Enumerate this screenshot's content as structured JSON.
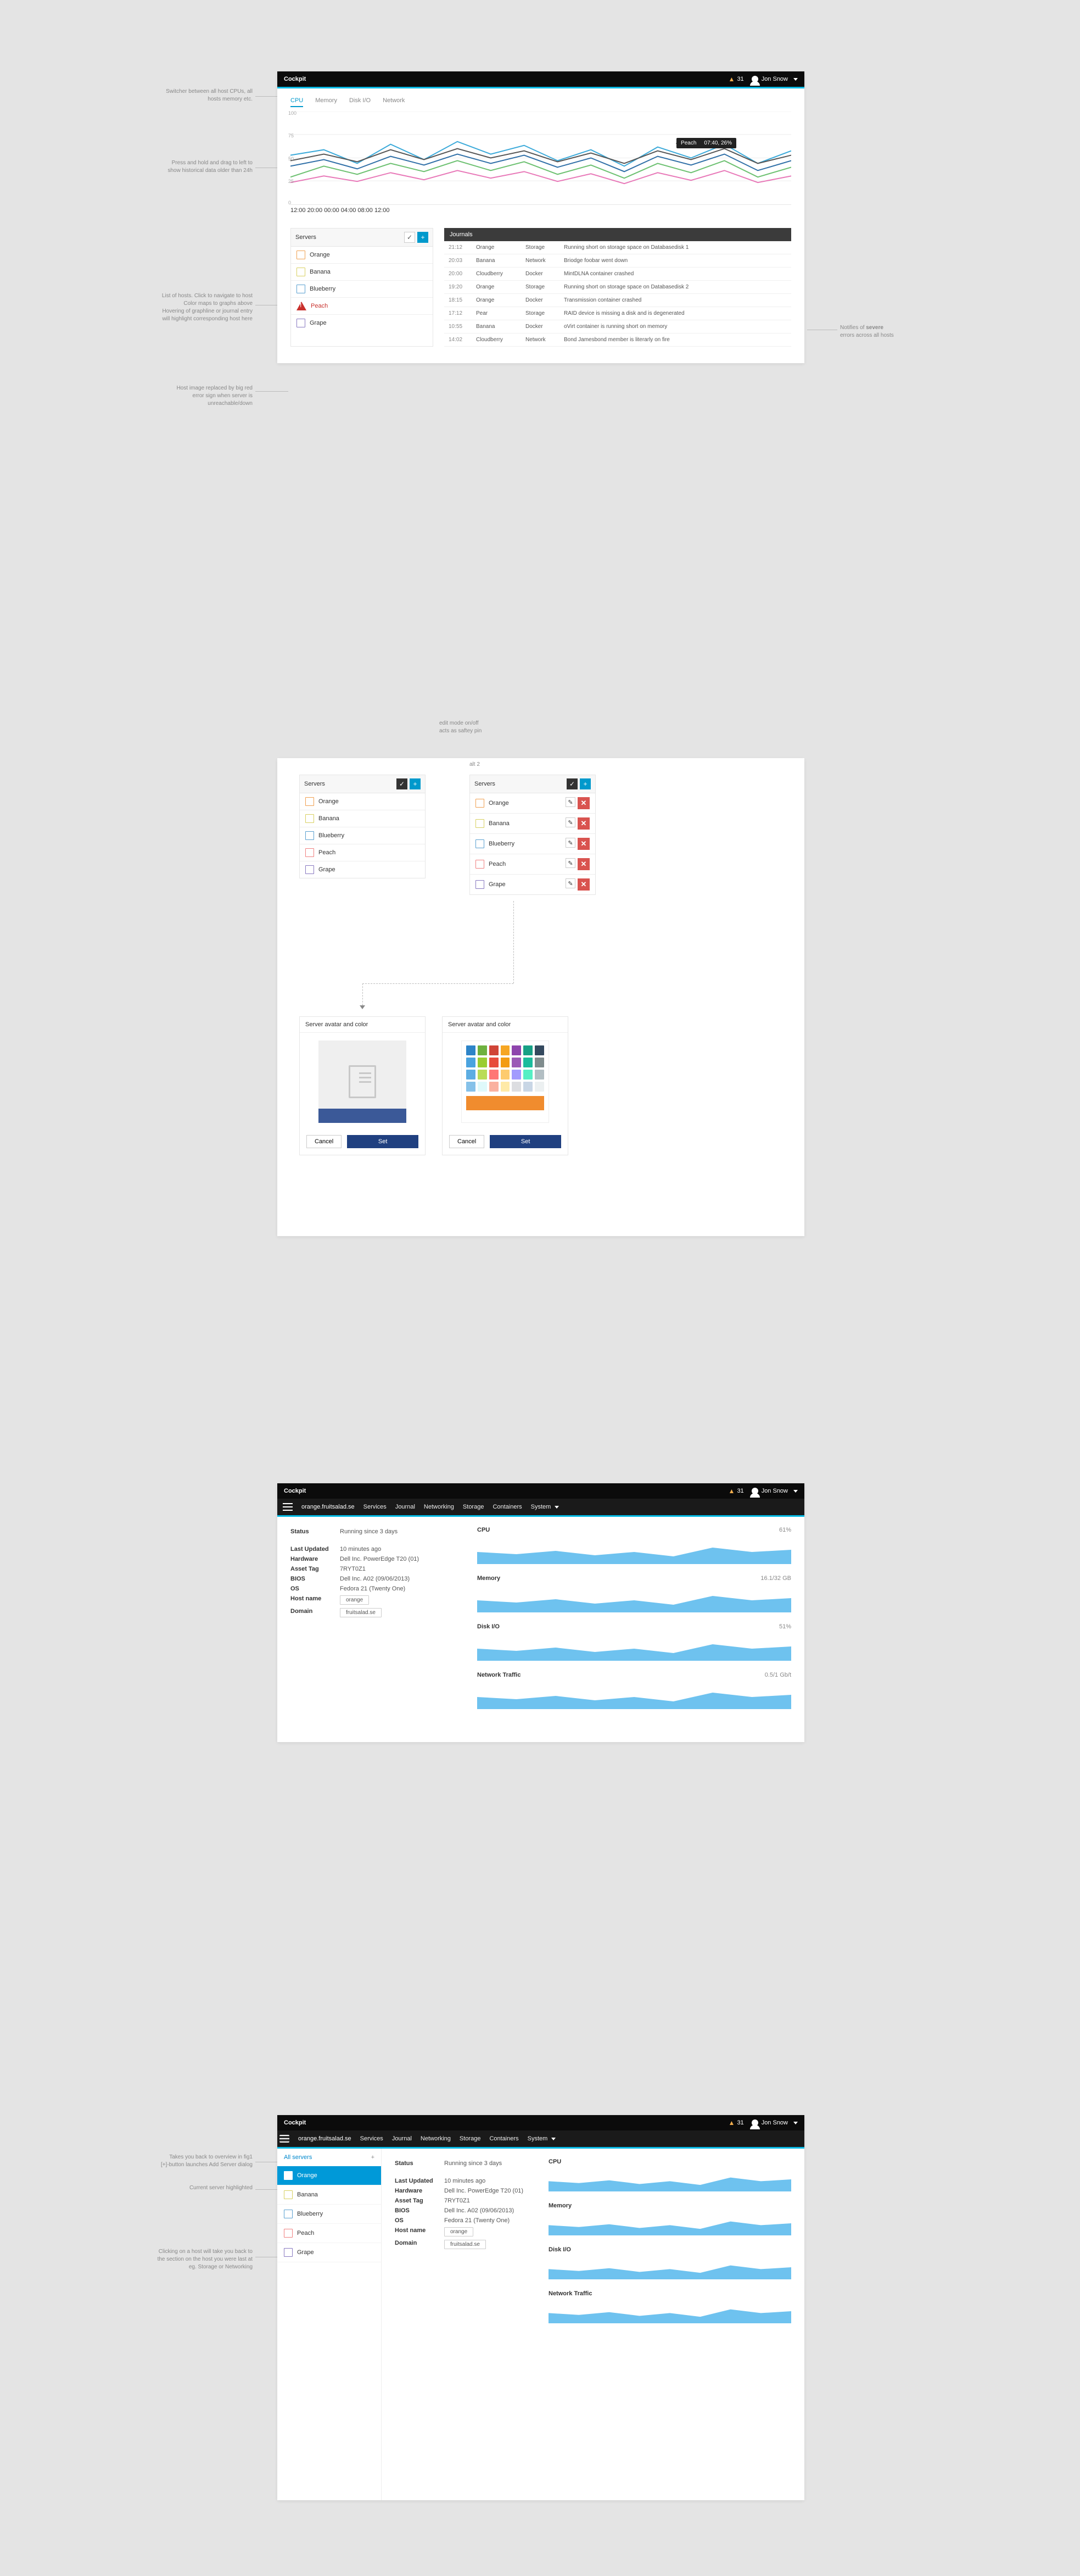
{
  "common": {
    "brand": "Cockpit",
    "alert_count": "31",
    "user_name": "Jon Snow"
  },
  "annotations": {
    "a1": "Switcher between all host CPUs, all\nhosts memory etc.",
    "a2": "Press and hold and drag to left to\nshow historical data older than 24h",
    "a3": "List of hosts. Click to navigate to host\nColor maps to graphs above\nHovering of graphline or journal entry\nwill highlight corresponding host here",
    "a4": "Host image replaced by big red\nerror sign when server is\nunreachable/down",
    "a5": "Notifies of severe\nerrors across all hosts",
    "a6": "edit mode on/off\nacts as saftey pin",
    "a6b": "alt 2",
    "a7": "Takes you back to overview in fig1\n[+]-button launches Add Server dialog",
    "a8": "Current server highlighted",
    "a9": "Clicking on a host will take you back to\nthe section on the host you were last at\neg. Storage or Networking"
  },
  "mock1": {
    "tabs": [
      "CPU",
      "Memory",
      "Disk I/O",
      "Network"
    ],
    "active_tab": 0,
    "y_ticks": [
      "100",
      "75",
      "50",
      "25",
      "0"
    ],
    "x_ticks": [
      "12:00",
      "20:00",
      "00:00",
      "04:00",
      "08:00",
      "12:00"
    ],
    "tooltip": {
      "host": "Peach",
      "value": "07:40, 26%"
    },
    "servers_title": "Servers",
    "hosts": [
      {
        "name": "Orange",
        "cls": "sw-orange"
      },
      {
        "name": "Banana",
        "cls": "sw-banana"
      },
      {
        "name": "Blueberry",
        "cls": "sw-blue"
      },
      {
        "name": "Peach",
        "cls": "peach-err"
      },
      {
        "name": "Grape",
        "cls": "sw-grape"
      }
    ],
    "journals_title": "Journals",
    "journal": [
      {
        "t": "21:12",
        "h": "Orange",
        "c": "Storage",
        "m": "Running short on storage space on Databasedisk 1"
      },
      {
        "t": "20:03",
        "h": "Banana",
        "c": "Network",
        "m": "Briodge foobar went down"
      },
      {
        "t": "20:00",
        "h": "Cloudberry",
        "c": "Docker",
        "m": "MintDLNA container crashed"
      },
      {
        "t": "19:20",
        "h": "Orange",
        "c": "Storage",
        "m": "Running short on storage space on Databasedisk 2"
      },
      {
        "t": "18:15",
        "h": "Orange",
        "c": "Docker",
        "m": "Transmission container crashed"
      },
      {
        "t": "17:12",
        "h": "Pear",
        "c": "Storage",
        "m": "RAID device is missing a disk and is degenerated"
      },
      {
        "t": "10:55",
        "h": "Banana",
        "c": "Docker",
        "m": "oVirt container is running short on memory"
      },
      {
        "t": "14:02",
        "h": "Cloudberry",
        "c": "Network",
        "m": "Bond Jamesbond member is literarly on fire"
      }
    ]
  },
  "mock2": {
    "servers_title": "Servers",
    "hosts": [
      "Orange",
      "Banana",
      "Blueberry",
      "Peach",
      "Grape"
    ],
    "host_cls": [
      "sw-orange",
      "sw-banana",
      "sw-blue",
      "sw-peach",
      "sw-grape"
    ],
    "card_title": "Server avatar and color",
    "cancel": "Cancel",
    "set": "Set",
    "colors": [
      "#2d84c8",
      "#6eb13f",
      "#d04437",
      "#f6a623",
      "#8e44ad",
      "#16a085",
      "#34495e",
      "#4aa3df",
      "#9acd32",
      "#e74c3c",
      "#f39c12",
      "#9b59b6",
      "#1abc9c",
      "#7f8c8d",
      "#5dade2",
      "#badc58",
      "#ff7675",
      "#fdcb6e",
      "#a29bfe",
      "#55efc4",
      "#b2bec3",
      "#85c1e9",
      "#dff9fb",
      "#fab1a0",
      "#ffeaa7",
      "#dcdde1",
      "#c8d6e5",
      "#ecf0f1"
    ]
  },
  "mock3": {
    "hostname": "orange.fruitsalad.se",
    "nav": [
      "Services",
      "Journal",
      "Networking",
      "Storage",
      "Containers",
      "System"
    ],
    "info": [
      {
        "k": "Status",
        "v": "Running since 3 days"
      },
      {
        "k": "Last Updated",
        "v": "10 minutes ago"
      },
      {
        "k": "Hardware",
        "v": "Dell Inc. PowerEdge T20 (01)"
      },
      {
        "k": "Asset Tag",
        "v": "7RYT0Z1"
      },
      {
        "k": "BIOS",
        "v": "Dell Inc. A02 (09/06/2013)"
      },
      {
        "k": "OS",
        "v": "Fedora 21 (Twenty One)"
      },
      {
        "k": "Host name",
        "v": "orange",
        "pill": true
      },
      {
        "k": "Domain",
        "v": "fruitsalad.se",
        "pill": true
      }
    ],
    "metrics": [
      {
        "name": "CPU",
        "val": "61%"
      },
      {
        "name": "Memory",
        "val": "16.1/32 GB"
      },
      {
        "name": "Disk I/O",
        "val": "51%"
      },
      {
        "name": "Network Traffic",
        "val": "0.5/1 Gb/t"
      }
    ]
  },
  "mock4": {
    "all_servers": "All servers",
    "plus": "+",
    "hosts": [
      {
        "name": "Orange",
        "cls": "sw-orange",
        "active": true
      },
      {
        "name": "Banana",
        "cls": "sw-banana"
      },
      {
        "name": "Blueberry",
        "cls": "sw-blue"
      },
      {
        "name": "Peach",
        "cls": "sw-peach"
      },
      {
        "name": "Grape",
        "cls": "sw-grape"
      }
    ],
    "metrics_names": [
      "CPU",
      "Memory",
      "Disk I/O",
      "Network Traffic"
    ]
  }
}
